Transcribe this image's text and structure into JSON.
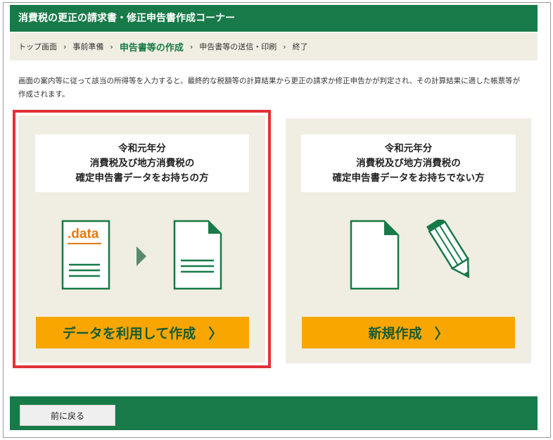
{
  "header": {
    "title": "消費税の更正の請求書・修正申告書作成コーナー"
  },
  "breadcrumb": {
    "items": [
      "トップ画面",
      "事前準備",
      "申告書等の作成",
      "申告書等の送信・印刷",
      "終了"
    ],
    "current_index": 2,
    "separator": "›"
  },
  "description": {
    "line1": "画面の案内等に従って該当の所得等を入力すると、最終的な税額等の計算結果から更正の請求か修正申告かが判定され、その計算結果に適した帳票等が",
    "line2": "作成されます。"
  },
  "cards": {
    "left": {
      "title_line1": "令和元年分",
      "title_line2": "消費税及び地方消費税の",
      "title_line3": "確定申告書データをお持ちの方",
      "file_label": ".data",
      "button_label": "データを利用して作成",
      "button_chevron": "〉"
    },
    "right": {
      "title_line1": "令和元年分",
      "title_line2": "消費税及び地方消費税の",
      "title_line3": "確定申告書データをお持ちでない方",
      "button_label": "新規作成",
      "button_chevron": "〉"
    }
  },
  "footer": {
    "back_label": "前に戻る"
  },
  "colors": {
    "brand_green": "#177a48",
    "panel_beige": "#f0ede2",
    "button_orange": "#f9a600",
    "selection_red": "#e13237",
    "data_orange": "#e67a12"
  }
}
